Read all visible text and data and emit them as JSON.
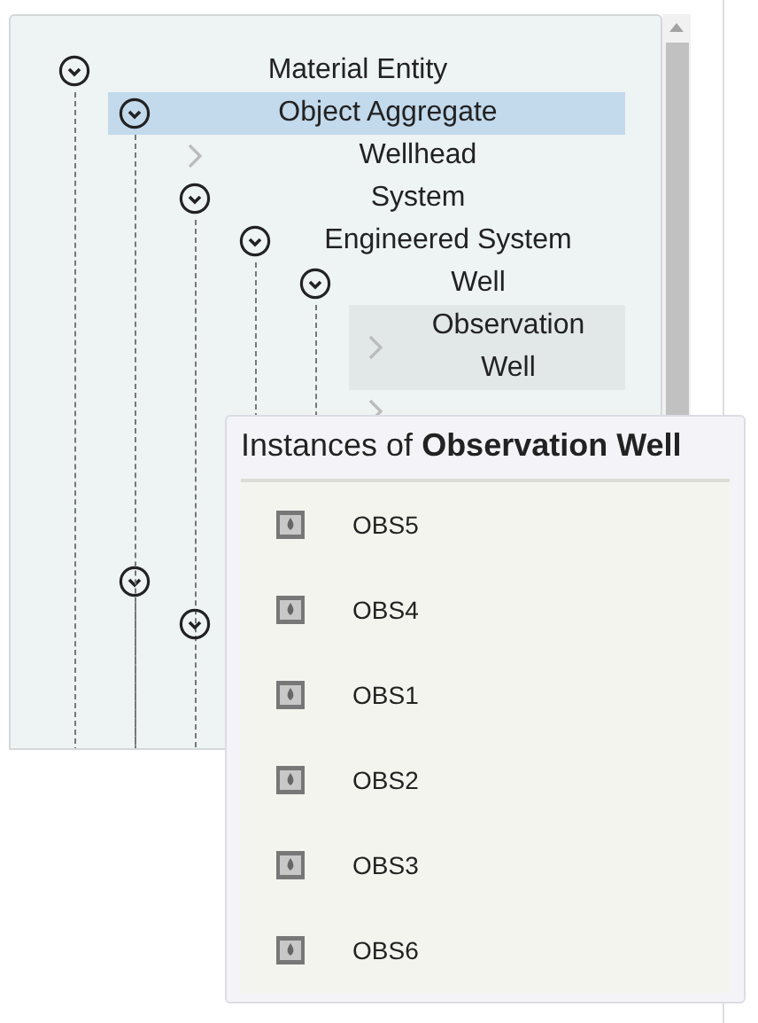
{
  "tree": [
    {
      "label": "Material Entity",
      "expanded": true,
      "selected": false,
      "children": [
        {
          "label": "Object Aggregate",
          "expanded": true,
          "selected": true,
          "children": [
            {
              "label": "Wellhead",
              "expanded": false,
              "selected": false
            },
            {
              "label": "System",
              "expanded": true,
              "selected": false,
              "children": [
                {
                  "label": "Engineered System",
                  "expanded": true,
                  "selected": false,
                  "children": [
                    {
                      "label": "Well",
                      "expanded": true,
                      "selected": false,
                      "children": [
                        {
                          "label": "Observation Well",
                          "expanded": false,
                          "selected": false,
                          "hovered": true
                        },
                        {
                          "expanded": false,
                          "selected": false,
                          "hovered": false
                        }
                      ]
                    }
                  ]
                }
              ]
            }
          ]
        },
        {
          "expanded": true,
          "selected": false,
          "children": [
            {
              "expanded": true,
              "selected": false
            }
          ]
        }
      ]
    }
  ],
  "popup": {
    "title": "Instances of **Observation Well**",
    "instances": [
      {
        "label": "OBS5"
      },
      {
        "label": "OBS4"
      },
      {
        "label": "OBS1"
      },
      {
        "label": "OBS2"
      },
      {
        "label": "OBS3"
      },
      {
        "label": "OBS6"
      }
    ]
  }
}
